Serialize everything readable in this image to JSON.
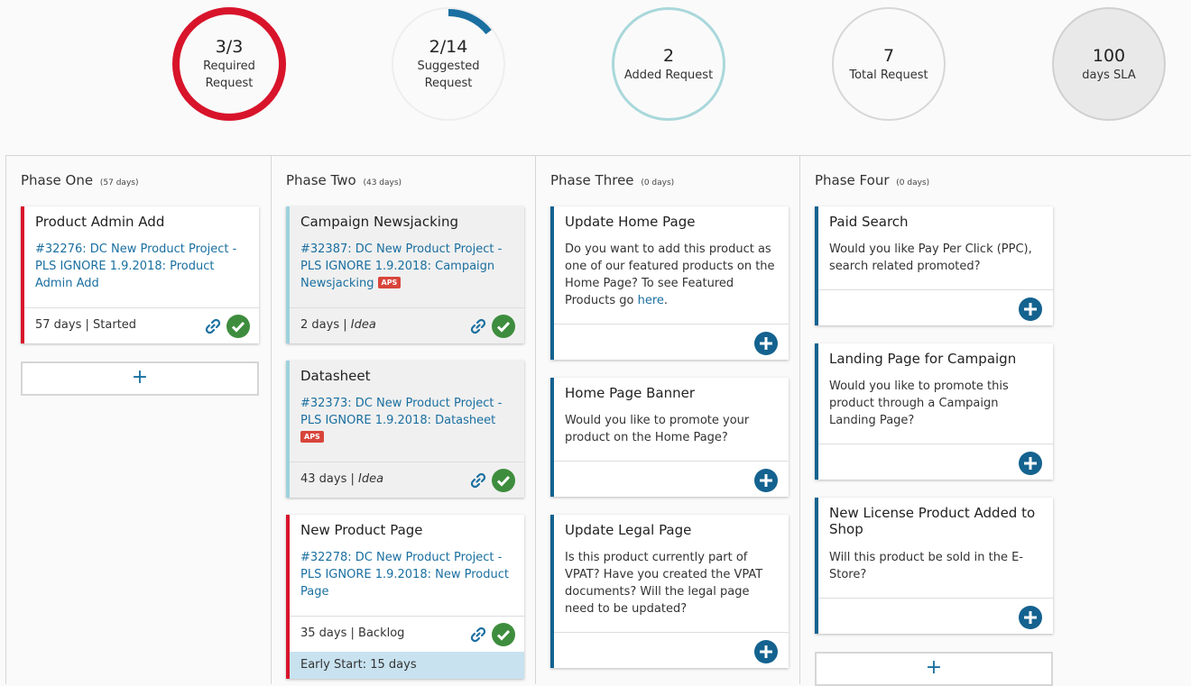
{
  "stats": {
    "required": {
      "value": "3/3",
      "label1": "Required",
      "label2": "Request",
      "color": "#d8142b"
    },
    "suggested": {
      "value": "2/14",
      "label1": "Suggested",
      "label2": "Request",
      "progress": 0.143,
      "color": "#1a6fa0"
    },
    "added": {
      "value": "2",
      "label": "Added Request",
      "color": "#a9d8db"
    },
    "total": {
      "value": "7",
      "label": "Total Request"
    },
    "sla": {
      "value": "100",
      "label": "days SLA"
    }
  },
  "phases": [
    {
      "title": "Phase One",
      "days": "(57 days)",
      "cards": [
        {
          "title": "Product Admin Add",
          "link": "#32276: DC New Product Project - PLS IGNORE 1.9.2018: Product Admin Add",
          "days": "57 days",
          "status": "Started"
        }
      ],
      "add_label": "+"
    },
    {
      "title": "Phase Two",
      "days": "(43 days)",
      "cards": [
        {
          "title": "Campaign Newsjacking",
          "link": "#32387: DC New Product Project - PLS IGNORE 1.9.2018: Campaign Newsjacking",
          "badge": "APS",
          "days": "2 days",
          "status": "Idea"
        },
        {
          "title": "Datasheet",
          "link": "#32373: DC New Product Project - PLS IGNORE 1.9.2018: Datasheet",
          "badge": "APS",
          "days": "43 days",
          "status": "Idea"
        },
        {
          "title": "New Product Page",
          "link": "#32278: DC New Product Project - PLS IGNORE 1.9.2018: New Product Page",
          "days": "35 days",
          "status": "Backlog",
          "early_start": "Early Start: 15 days"
        }
      ]
    },
    {
      "title": "Phase Three",
      "days": "(0 days)",
      "cards": [
        {
          "title": "Update Home Page",
          "body": "Do you want to add this product as one of our featured products on the Home Page? To see Featured Products go ",
          "body_link": "here",
          "body_end": "."
        },
        {
          "title": "Home Page Banner",
          "body": "Would you like to promote your product on the Home Page?"
        },
        {
          "title": "Update Legal Page",
          "body": "Is this product currently part of VPAT? Have you created the VPAT documents? Will the legal page need to be updated?"
        }
      ]
    },
    {
      "title": "Phase Four",
      "days": "(0 days)",
      "cards": [
        {
          "title": "Paid Search",
          "body": "Would you like Pay Per Click (PPC), search related promoted?"
        },
        {
          "title": "Landing Page for Campaign",
          "body": "Would you like to promote this product through a Campaign Landing Page?"
        },
        {
          "title": "New License Product Added to Shop",
          "body": "Will this product be sold in the E-Store?"
        }
      ],
      "add_label": "+"
    }
  ],
  "separator": "|",
  "colors": {
    "accent": "#1a6fa0",
    "required": "#d8142b",
    "check": "#3e8d3e",
    "plus": "#14628f"
  }
}
